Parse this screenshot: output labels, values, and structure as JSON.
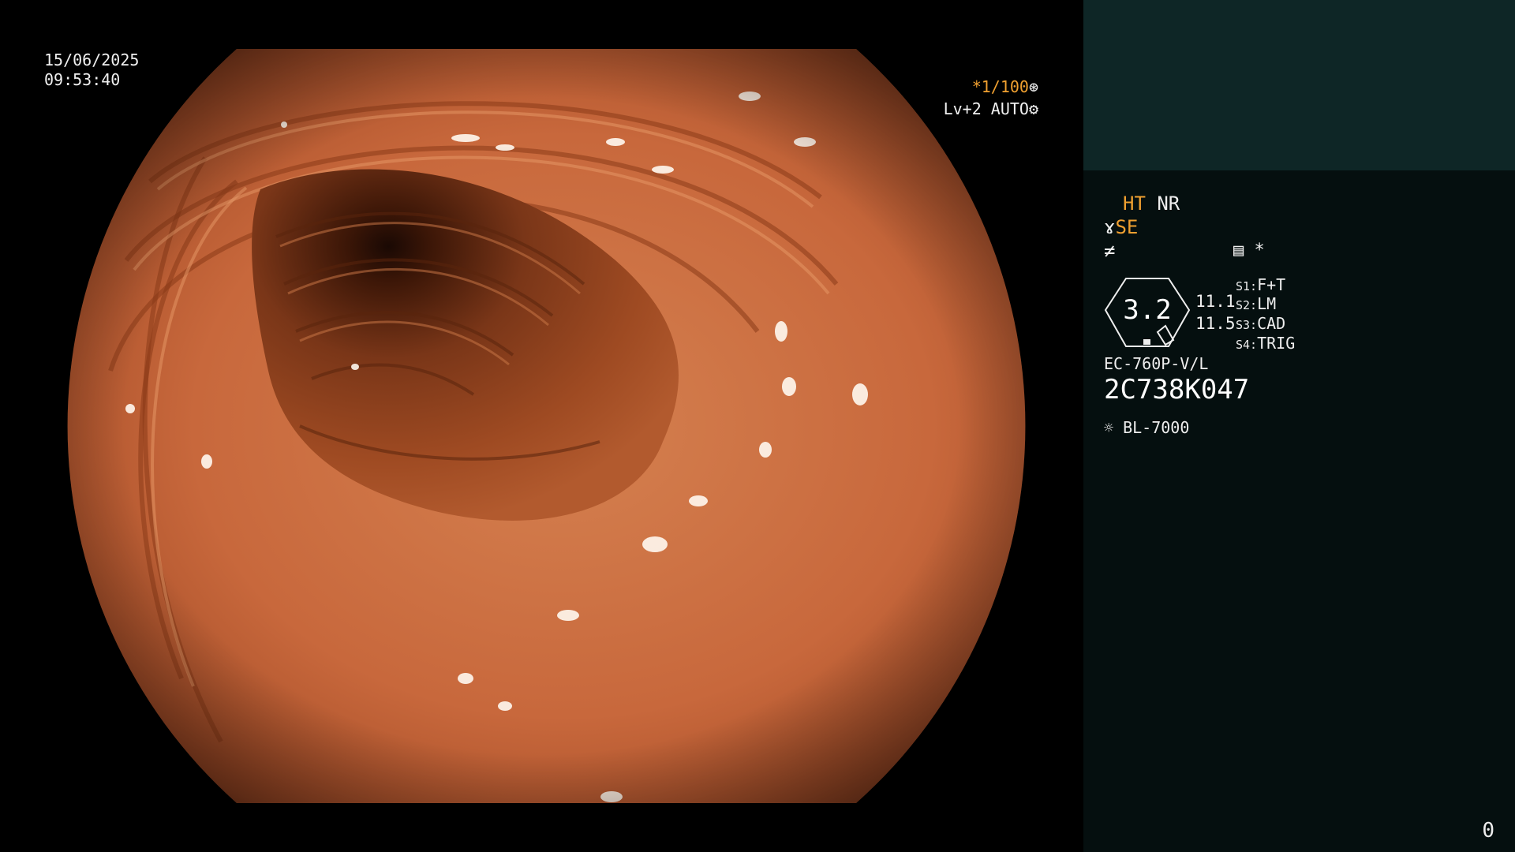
{
  "osd": {
    "date": "15/06/2025",
    "time": "09:53:40",
    "shutter": "*1/100",
    "shutter_icon": "wheel-icon",
    "iris": "Lv+2 AUTO",
    "iris_icon": "gear-icon"
  },
  "panel": {
    "modes": {
      "ht": "HT",
      "nr": "NR"
    },
    "se": "SE",
    "se_icon": "scope-curve-icon",
    "enhance_icon": "enhance-slash-icon",
    "menu_icon": "menu-list-icon",
    "star": "*",
    "zoom": "3.2",
    "levels": [
      "11.1",
      "11.5"
    ],
    "switches": [
      {
        "key": "S1:",
        "value": "F+T"
      },
      {
        "key": "S2:",
        "value": "LM"
      },
      {
        "key": "S3:",
        "value": "CAD"
      },
      {
        "key": "S4:",
        "value": "TRIG"
      }
    ],
    "scope_model": "EC-760P-V/L",
    "serial": "2C738K047",
    "light_source_icon": "sun-icon",
    "light_source": "BL-7000",
    "counter": "0"
  },
  "colors": {
    "accent_orange": "#f0a030",
    "panel_header": "#0e2626",
    "panel_body": "#050f0f",
    "tissue": "#c8683c"
  }
}
